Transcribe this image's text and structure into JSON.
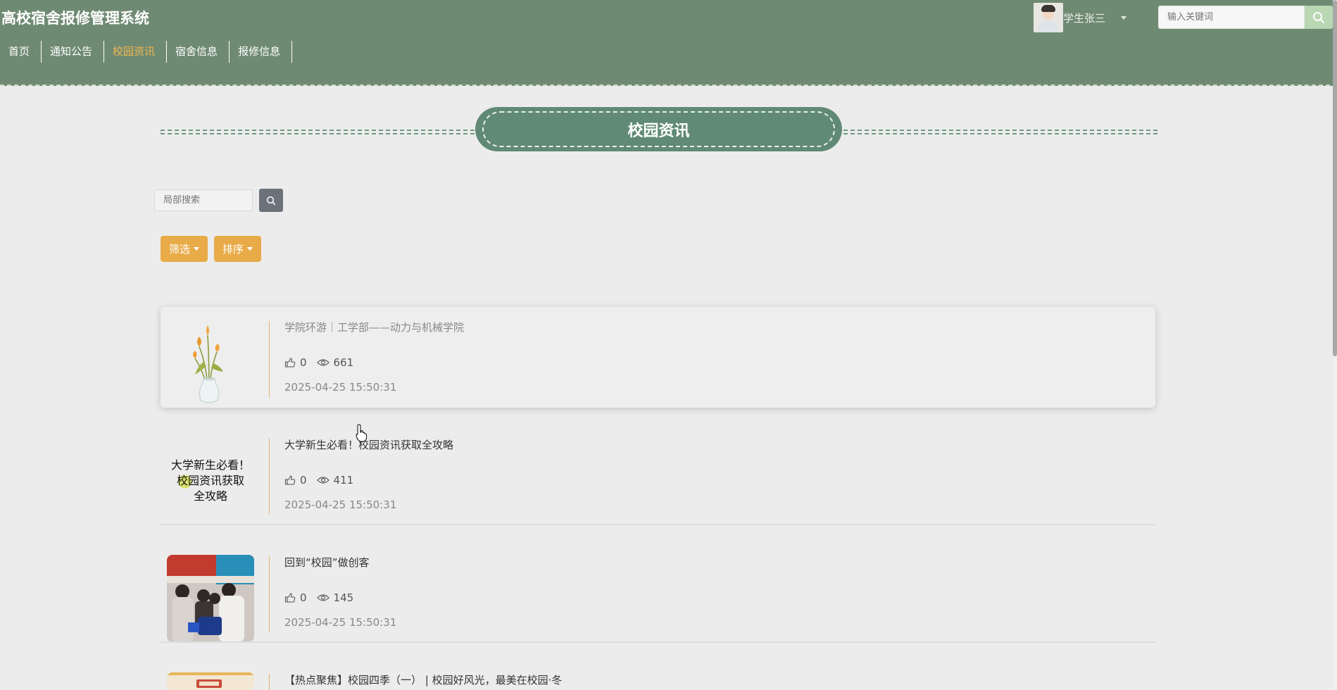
{
  "header": {
    "site_title": "高校宿舍报修管理系统",
    "nav": [
      {
        "label": "首页",
        "active": false
      },
      {
        "label": "通知公告",
        "active": false
      },
      {
        "label": "校园资讯",
        "active": true
      },
      {
        "label": "宿舍信息",
        "active": false
      },
      {
        "label": "报修信息",
        "active": false
      }
    ],
    "user_name": "学生张三",
    "search_placeholder": "输入关键词"
  },
  "page_title": "校园资讯",
  "local_search_placeholder": "局部搜索",
  "filter_label": "筛选",
  "sort_label": "排序",
  "items": [
    {
      "title": "学院环游｜工学部——动力与机械学院",
      "likes": "0",
      "views": "661",
      "time": "2025-04-25 15:50:31",
      "thumb_icon": "tulip-vase-image"
    },
    {
      "title": "大学新生必看！校园资讯获取全攻略",
      "likes": "0",
      "views": "411",
      "time": "2025-04-25 15:50:31",
      "thumb_text": [
        "大学新生必看！",
        "校园资讯获取",
        "全攻略"
      ]
    },
    {
      "title": "回到“校园”做创客",
      "likes": "0",
      "views": "145",
      "time": "2025-04-25 15:50:31",
      "thumb_icon": "students-photo"
    },
    {
      "title": "【热点聚焦】校园四季（一） | 校园好风光，最美在校园·冬",
      "thumb_icon": "season-poster-image"
    }
  ],
  "colors": {
    "header_bg": "#6f8a72",
    "accent": "#e8ab48",
    "active_nav": "#f0b64e",
    "banner": "#608a75"
  }
}
